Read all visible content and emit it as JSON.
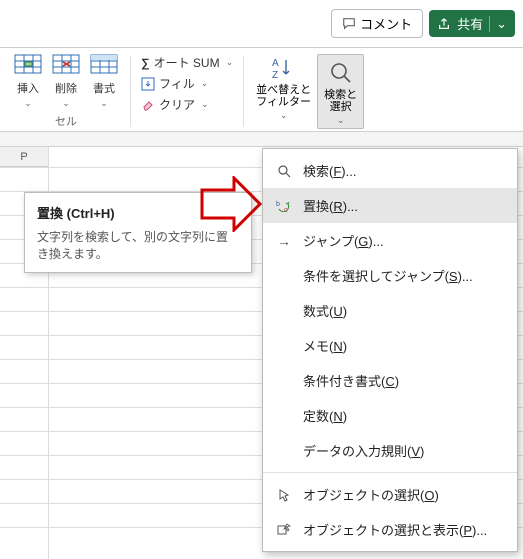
{
  "topbar": {
    "comment": "コメント",
    "share": "共有"
  },
  "ribbon": {
    "insert": "挿入",
    "delete": "削除",
    "format": "書式",
    "cells_group": "セル",
    "autosum": "オート SUM",
    "fill": "フィル",
    "clear": "クリア",
    "sort_filter_l1": "並べ替えと",
    "sort_filter_l2": "フィルター",
    "find_select_l1": "検索と",
    "find_select_l2": "選択"
  },
  "sheet": {
    "col_p": "P"
  },
  "tooltip": {
    "title": "置換 (Ctrl+H)",
    "body": "文字列を検索して、別の文字列に置き換えます。"
  },
  "menu": {
    "find_pre": "検索(",
    "find_key": "F",
    "find_post": ")...",
    "replace_pre": "置換(",
    "replace_key": "R",
    "replace_post": ")...",
    "goto_pre": "ジャンプ(",
    "goto_key": "G",
    "goto_post": ")...",
    "goto_special_pre": "条件を選択してジャンプ(",
    "goto_special_key": "S",
    "goto_special_post": ")...",
    "formulas_pre": "数式(",
    "formulas_key": "U",
    "formulas_post": ")",
    "notes_pre": "メモ(",
    "notes_key": "N",
    "notes_post": ")",
    "cond_fmt_pre": "条件付き書式(",
    "cond_fmt_key": "C",
    "cond_fmt_post": ")",
    "constants_pre": "定数(",
    "constants_key": "N",
    "constants_post": ")",
    "validation_pre": "データの入力規則(",
    "validation_key": "V",
    "validation_post": ")",
    "select_obj_pre": "オブジェクトの選択(",
    "select_obj_key": "O",
    "select_obj_post": ")",
    "selection_pane_pre": "オブジェクトの選択と表示(",
    "selection_pane_key": "P",
    "selection_pane_post": ")..."
  }
}
